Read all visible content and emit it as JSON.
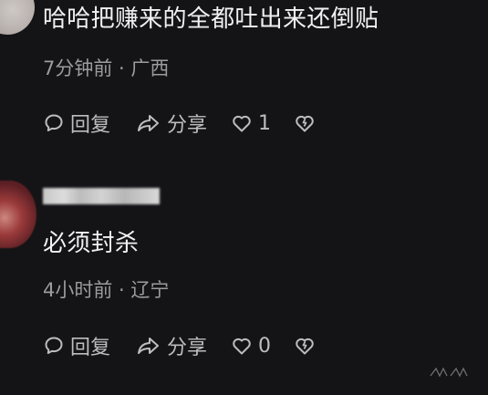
{
  "comments": [
    {
      "text": "哈哈把赚来的全都吐出来还倒贴",
      "time_location": "7分钟前 · 广西",
      "reply_label": "回复",
      "share_label": "分享",
      "like_count": "1"
    },
    {
      "username": "",
      "text": "必须封杀",
      "time_location": "4小时前 · 辽宁",
      "reply_label": "回复",
      "share_label": "分享",
      "like_count": "0"
    }
  ],
  "icons": {
    "reply": "speech-bubble-icon",
    "share": "share-arrow-icon",
    "like": "heart-icon",
    "dislike": "broken-heart-icon"
  },
  "colors": {
    "background": "#141416",
    "text": "#f1f1f2",
    "meta": "#9b9ba0",
    "actions": "#bdbdc1"
  }
}
